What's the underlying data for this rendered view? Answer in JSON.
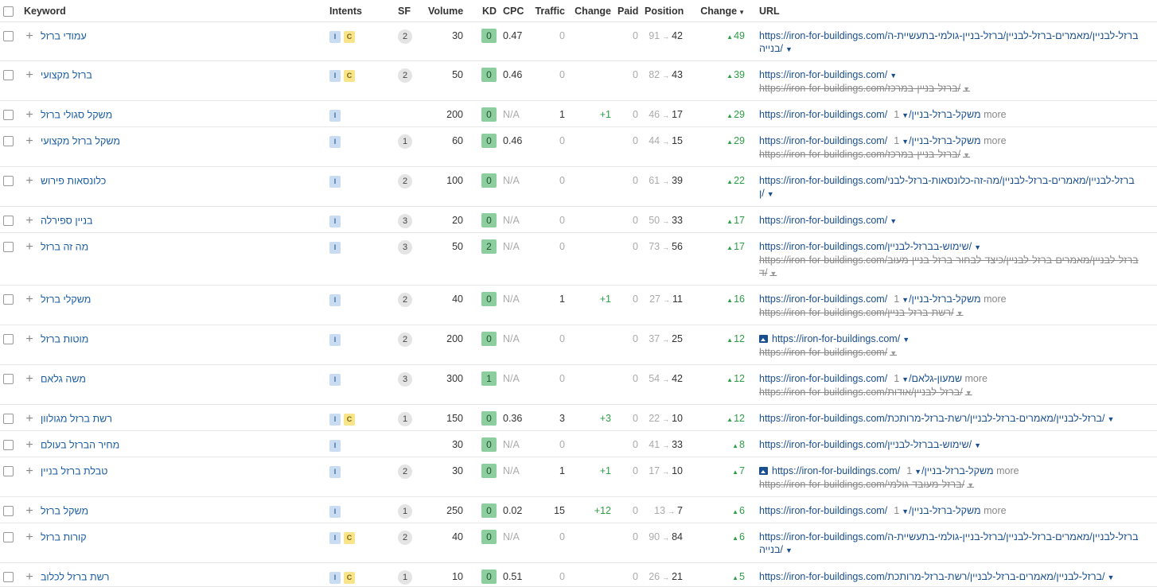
{
  "headers": {
    "keyword": "Keyword",
    "intents": "Intents",
    "sf": "SF",
    "volume": "Volume",
    "kd": "KD",
    "cpc": "CPC",
    "traffic": "Traffic",
    "change": "Change",
    "paid": "Paid",
    "position": "Position",
    "change2": "Change",
    "url": "URL"
  },
  "colors": {
    "intent_i": "#c9dcf2",
    "intent_c": "#f8e58a",
    "kd_green": "#8cce9e",
    "link": "#1a4f8f",
    "up": "#2e9e45"
  },
  "rows": [
    {
      "keyword": "עמודי ברזל",
      "i": "I",
      "c": "C",
      "sf": "2",
      "volume": "30",
      "kd": "0",
      "cpc": "0.47",
      "traffic": "0",
      "tchange": "",
      "paid": "0",
      "pos_from": "91",
      "pos_to": "42",
      "change": "49",
      "url": "https://iron-for-buildings.com/ברזל-לבניין/מאמרים-ברזל-לבניין/ברזל-בניין-גולמי-בתעשיית-ה",
      "url_cont": "בנייה/",
      "sub": "",
      "more": ""
    },
    {
      "keyword": "ברזל מקצועי",
      "i": "I",
      "c": "C",
      "sf": "2",
      "volume": "50",
      "kd": "0",
      "cpc": "0.46",
      "traffic": "0",
      "tchange": "",
      "paid": "0",
      "pos_from": "82",
      "pos_to": "43",
      "change": "39",
      "url": "https://iron-for-buildings.com/",
      "url_cont": "",
      "sub": "https://iron-for-buildings.com/ברזל-בניין-במרכז/",
      "more": ""
    },
    {
      "keyword": "משקל סגולי ברזל",
      "i": "I",
      "c": "",
      "sf": "",
      "volume": "200",
      "kd": "0",
      "cpc": "N/A",
      "traffic": "1",
      "tchange": "+1",
      "paid": "0",
      "pos_from": "46",
      "pos_to": "17",
      "change": "29",
      "url": "https://iron-for-buildings.com/משקל-ברזל-בניין/",
      "url_cont": "",
      "sub": "",
      "more": "1 more"
    },
    {
      "keyword": "משקל ברזל מקצועי",
      "i": "I",
      "c": "",
      "sf": "1",
      "volume": "60",
      "kd": "0",
      "cpc": "0.46",
      "traffic": "0",
      "tchange": "",
      "paid": "0",
      "pos_from": "44",
      "pos_to": "15",
      "change": "29",
      "url": "https://iron-for-buildings.com/משקל-ברזל-בניין/",
      "url_cont": "",
      "sub": "https://iron-for-buildings.com/ברזל-בניין-במרכז/",
      "more": "1 more"
    },
    {
      "keyword": "כלונסאות פירוש",
      "i": "I",
      "c": "",
      "sf": "2",
      "volume": "100",
      "kd": "0",
      "cpc": "N/A",
      "traffic": "0",
      "tchange": "",
      "paid": "0",
      "pos_from": "61",
      "pos_to": "39",
      "change": "22",
      "url": "https://iron-for-buildings.com/ברזל-לבניין/מאמרים-ברזל-לבניין/מה-זה-כלונסאות-ברזל-לבני",
      "url_cont": "ן/",
      "sub": "",
      "more": ""
    },
    {
      "keyword": "בניין ספירלה",
      "i": "I",
      "c": "",
      "sf": "3",
      "volume": "20",
      "kd": "0",
      "cpc": "N/A",
      "traffic": "0",
      "tchange": "",
      "paid": "0",
      "pos_from": "50",
      "pos_to": "33",
      "change": "17",
      "url": "https://iron-for-buildings.com/",
      "url_cont": "",
      "sub": "",
      "more": ""
    },
    {
      "keyword": "מה זה ברזל",
      "i": "I",
      "c": "",
      "sf": "3",
      "volume": "50",
      "kd": "2",
      "cpc": "N/A",
      "traffic": "0",
      "tchange": "",
      "paid": "0",
      "pos_from": "73",
      "pos_to": "56",
      "change": "17",
      "url": "https://iron-for-buildings.com/שימוש-בברזל-לבניין/",
      "url_cont": "",
      "sub": "https://iron-for-buildings.com/ברזל-לבניין/מאמרים-ברזל-לבניין/כיצד-לבחור-ברזל-בניין-מעוב",
      "sub_cont": "ד/",
      "more": ""
    },
    {
      "keyword": "משקלי ברזל",
      "i": "I",
      "c": "",
      "sf": "2",
      "volume": "40",
      "kd": "0",
      "cpc": "N/A",
      "traffic": "1",
      "tchange": "+1",
      "paid": "0",
      "pos_from": "27",
      "pos_to": "11",
      "change": "16",
      "url": "https://iron-for-buildings.com/משקל-ברזל-בניין/",
      "url_cont": "",
      "sub": "https://iron-for-buildings.com/רשת-ברזל-בניין/",
      "more": "1 more"
    },
    {
      "keyword": "מוטות ברזל",
      "i": "I",
      "c": "",
      "sf": "2",
      "volume": "200",
      "kd": "0",
      "cpc": "N/A",
      "traffic": "0",
      "tchange": "",
      "paid": "0",
      "pos_from": "37",
      "pos_to": "25",
      "change": "12",
      "url": "https://iron-for-buildings.com/",
      "url_cont": "",
      "sub": "https://iron-for-buildings.com/",
      "more": "",
      "img": "1"
    },
    {
      "keyword": "משה גלאם",
      "i": "I",
      "c": "",
      "sf": "3",
      "volume": "300",
      "kd": "1",
      "cpc": "N/A",
      "traffic": "0",
      "tchange": "",
      "paid": "0",
      "pos_from": "54",
      "pos_to": "42",
      "change": "12",
      "url": "https://iron-for-buildings.com/שמעון-גלאם/",
      "url_cont": "",
      "sub": "https://iron-for-buildings.com/ברזל-לבניין/אודות/",
      "more": "1 more"
    },
    {
      "keyword": "רשת ברזל מגולוון",
      "i": "I",
      "c": "C",
      "sf": "1",
      "volume": "150",
      "kd": "0",
      "cpc": "0.36",
      "traffic": "3",
      "tchange": "+3",
      "paid": "0",
      "pos_from": "22",
      "pos_to": "10",
      "change": "12",
      "url": "https://iron-for-buildings.com/ברזל-לבניין/מאמרים-ברזל-לבניין/רשת-ברזל-מרותכת/",
      "url_cont": "",
      "sub": "",
      "more": ""
    },
    {
      "keyword": "מחיר הברזל בעולם",
      "i": "I",
      "c": "",
      "sf": "",
      "volume": "30",
      "kd": "0",
      "cpc": "N/A",
      "traffic": "0",
      "tchange": "",
      "paid": "0",
      "pos_from": "41",
      "pos_to": "33",
      "change": "8",
      "url": "https://iron-for-buildings.com/שימוש-בברזל-לבניין/",
      "url_cont": "",
      "sub": "",
      "more": ""
    },
    {
      "keyword": "טבלת ברזל בניין",
      "i": "I",
      "c": "",
      "sf": "2",
      "volume": "30",
      "kd": "0",
      "cpc": "N/A",
      "traffic": "1",
      "tchange": "+1",
      "paid": "0",
      "pos_from": "17",
      "pos_to": "10",
      "change": "7",
      "url": "https://iron-for-buildings.com/משקל-ברזל-בניין/",
      "url_cont": "",
      "sub": "https://iron-for-buildings.com/ברזל-מעובד-גולמי/",
      "more": "1 more",
      "img": "1"
    },
    {
      "keyword": "משקל ברזל",
      "i": "I",
      "c": "",
      "sf": "1",
      "volume": "250",
      "kd": "0",
      "cpc": "0.02",
      "traffic": "15",
      "tchange": "+12",
      "paid": "0",
      "pos_from": "13",
      "pos_to": "7",
      "change": "6",
      "url": "https://iron-for-buildings.com/משקל-ברזל-בניין/",
      "url_cont": "",
      "sub": "",
      "more": "1 more"
    },
    {
      "keyword": "קורות ברזל",
      "i": "I",
      "c": "C",
      "sf": "2",
      "volume": "40",
      "kd": "0",
      "cpc": "N/A",
      "traffic": "0",
      "tchange": "",
      "paid": "0",
      "pos_from": "90",
      "pos_to": "84",
      "change": "6",
      "url": "https://iron-for-buildings.com/ברזל-לבניין/מאמרים-ברזל-לבניין/ברזל-בניין-גולמי-בתעשיית-ה",
      "url_cont": "בנייה/",
      "sub": "",
      "more": ""
    },
    {
      "keyword": "רשת ברזל לכלוב",
      "i": "I",
      "c": "C",
      "sf": "1",
      "volume": "10",
      "kd": "0",
      "cpc": "0.51",
      "traffic": "0",
      "tchange": "",
      "paid": "0",
      "pos_from": "26",
      "pos_to": "21",
      "change": "5",
      "url": "https://iron-for-buildings.com/ברזל-לבניין/מאמרים-ברזל-לבניין/רשת-ברזל-מרותכת/",
      "url_cont": "",
      "sub": "",
      "more": ""
    }
  ]
}
